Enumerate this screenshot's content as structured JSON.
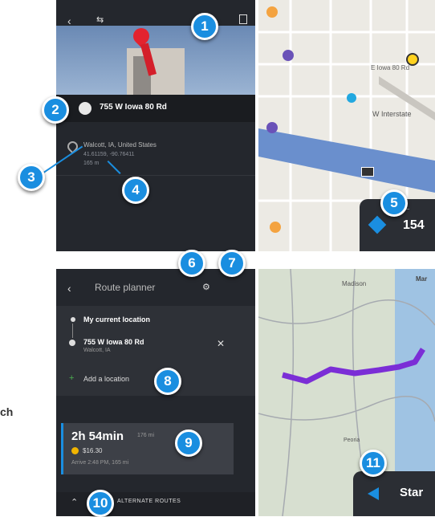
{
  "side_text": "ch",
  "screen1": {
    "address": "755 W Iowa 80 Rd",
    "location": "Walcott, IA, United States",
    "coordinates": "41.61159, -90.76411",
    "extra": "165 m",
    "map_labels": [
      "E Iowa 80 Rd",
      "W Interstate"
    ],
    "nav_value": "154"
  },
  "screen2": {
    "title": "Route planner",
    "start": "My current location",
    "destination": "755 W Iowa 80 Rd",
    "destination_sub": "Walcott, IA",
    "add_location": "Add a location",
    "duration": "2h 54min",
    "distance": "176 mi",
    "cost": "$16.30",
    "arrival": "Arrive 2:48 PM, 165 mi",
    "alternate_routes": "ALTERNATE ROUTES",
    "start_button": "Star",
    "map_labels": [
      "Madison",
      "Mar",
      "Peoria"
    ]
  },
  "callouts": [
    "1",
    "2",
    "3",
    "4",
    "5",
    "6",
    "7",
    "8",
    "9",
    "10",
    "11"
  ],
  "colors": {
    "callout": "#1a8ee0",
    "route": "#7b2ed6",
    "dark_panel": "#24272d"
  }
}
